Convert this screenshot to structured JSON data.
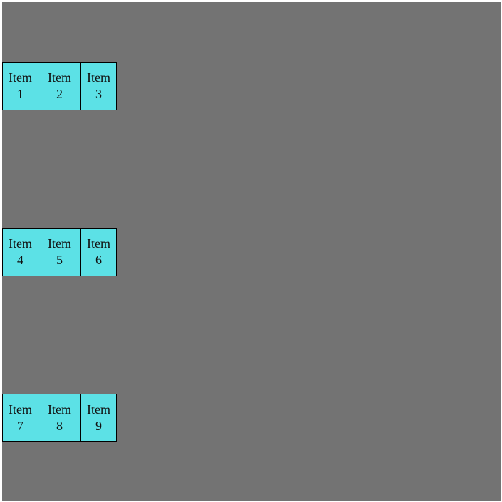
{
  "rows": [
    {
      "items": [
        {
          "line1": "Item",
          "line2": "1"
        },
        {
          "line1": "Item",
          "line2": "2"
        },
        {
          "line1": "Item",
          "line2": "3"
        }
      ]
    },
    {
      "items": [
        {
          "line1": "Item",
          "line2": "4"
        },
        {
          "line1": "Item",
          "line2": "5"
        },
        {
          "line1": "Item",
          "line2": "6"
        }
      ]
    },
    {
      "items": [
        {
          "line1": "Item",
          "line2": "7"
        },
        {
          "line1": "Item",
          "line2": "8"
        },
        {
          "line1": "Item",
          "line2": "9"
        }
      ]
    }
  ],
  "colors": {
    "background": "#737373",
    "item": "#5ce1e6",
    "border": "#000000"
  }
}
